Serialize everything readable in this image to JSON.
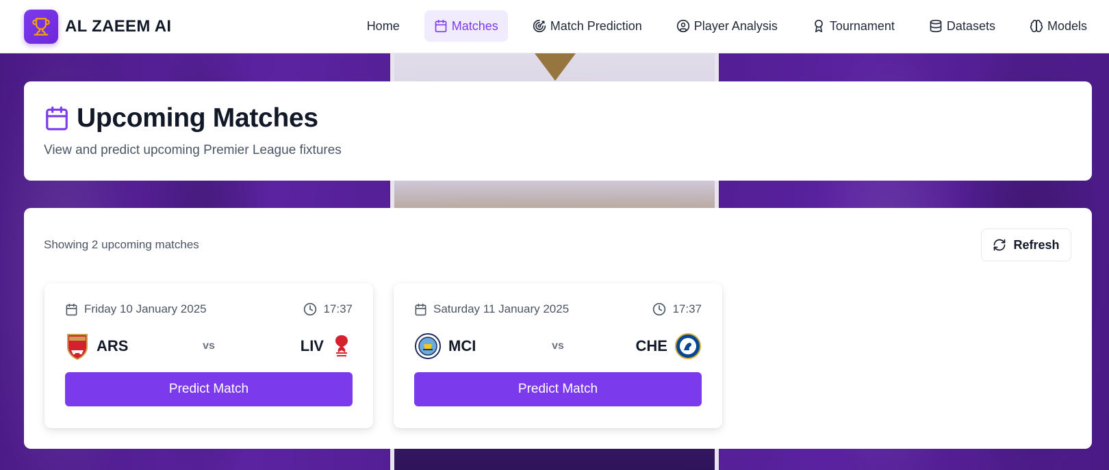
{
  "brand": {
    "name": "AL ZAEEM AI",
    "logo_icon": "trophy-icon"
  },
  "nav": {
    "items": [
      {
        "label": "Home",
        "icon": "",
        "active": false
      },
      {
        "label": "Matches",
        "icon": "calendar-icon",
        "active": true
      },
      {
        "label": "Match Prediction",
        "icon": "target-icon",
        "active": false
      },
      {
        "label": "Player Analysis",
        "icon": "user-circle-icon",
        "active": false
      },
      {
        "label": "Tournament",
        "icon": "award-icon",
        "active": false
      },
      {
        "label": "Datasets",
        "icon": "database-icon",
        "active": false
      },
      {
        "label": "Models",
        "icon": "brain-icon",
        "active": false
      }
    ]
  },
  "page": {
    "title": "Upcoming Matches",
    "subtitle": "View and predict upcoming Premier League fixtures"
  },
  "list": {
    "count_text": "Showing 2 upcoming matches",
    "refresh_label": "Refresh"
  },
  "matches": [
    {
      "date": "Friday 10 January 2025",
      "time": "17:37",
      "home": {
        "code": "ARS",
        "crest": "arsenal-crest-icon",
        "color": "#d5202e"
      },
      "vs": "vs",
      "away": {
        "code": "LIV",
        "crest": "liverpool-crest-icon",
        "color": "#d5202e"
      },
      "predict_label": "Predict Match"
    },
    {
      "date": "Saturday 11 January 2025",
      "time": "17:37",
      "home": {
        "code": "MCI",
        "crest": "man-city-crest-icon",
        "color": "#6cabdd"
      },
      "vs": "vs",
      "away": {
        "code": "CHE",
        "crest": "chelsea-crest-icon",
        "color": "#034694"
      },
      "predict_label": "Predict Match"
    }
  ],
  "colors": {
    "accent": "#7c3aed",
    "accent_bg": "#f1ecfd",
    "background_purple": "#4f1d8f"
  }
}
